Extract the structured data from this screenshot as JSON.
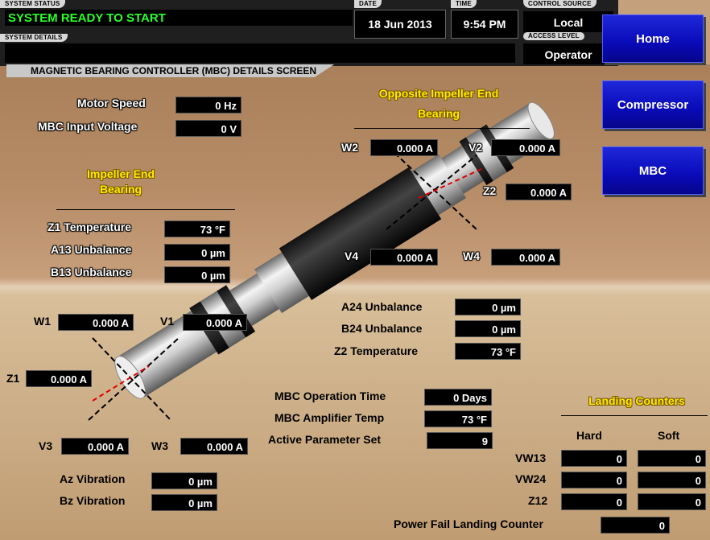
{
  "header": {
    "system_status_label": "SYSTEM STATUS",
    "system_status": "SYSTEM READY TO START",
    "system_details_label": "SYSTEM DETAILS",
    "system_details": "",
    "date_label": "DATE",
    "date": "18 Jun 2013",
    "time_label": "TIME",
    "time": "9:54 PM",
    "control_source_label": "CONTROL SOURCE",
    "control_source": "Local",
    "access_level_label": "ACCESS LEVEL",
    "access_level": "Operator"
  },
  "screen_title": "MAGNETIC BEARING CONTROLLER (MBC) DETAILS SCREEN",
  "nav": {
    "home": "Home",
    "compressor": "Compressor",
    "mbc": "MBC"
  },
  "general": {
    "motor_speed_label": "Motor Speed",
    "motor_speed": "0 Hz",
    "input_voltage_label": "MBC Input Voltage",
    "input_voltage": "0 V"
  },
  "impeller_end": {
    "title_line1": "Impeller End",
    "title_line2": "Bearing",
    "z1_temp_label": "Z1 Temperature",
    "z1_temp": "73 °F",
    "a13_label": "A13 Unbalance",
    "a13": "0 µm",
    "b13_label": "B13 Unbalance",
    "b13": "0 µm",
    "w1_label": "W1",
    "w1": "0.000 A",
    "v1_label": "V1",
    "v1": "0.000 A",
    "z1_label": "Z1",
    "z1": "0.000 A",
    "v3_label": "V3",
    "v3": "0.000 A",
    "w3_label": "W3",
    "w3": "0.000 A"
  },
  "opposite_end": {
    "title_line1": "Opposite Impeller End",
    "title_line2": "Bearing",
    "w2_label": "W2",
    "w2": "0.000 A",
    "v2_label": "V2",
    "v2": "0.000 A",
    "z2_label": "Z2",
    "z2": "0.000 A",
    "v4_label": "V4",
    "v4": "0.000 A",
    "w4_label": "W4",
    "w4": "0.000 A",
    "a24_label": "A24 Unbalance",
    "a24": "0 µm",
    "b24_label": "B24 Unbalance",
    "b24": "0 µm",
    "z2_temp_label": "Z2 Temperature",
    "z2_temp": "73 °F"
  },
  "operation": {
    "op_time_label": "MBC Operation Time",
    "op_time": "0 Days",
    "amp_temp_label": "MBC Amplifier Temp",
    "amp_temp": "73 °F",
    "param_set_label": "Active Parameter Set",
    "param_set": "9"
  },
  "vibration": {
    "az_label": "Az Vibration",
    "az": "0 µm",
    "bz_label": "Bz Vibration",
    "bz": "0 µm"
  },
  "landing": {
    "title": "Landing Counters",
    "hard_label": "Hard",
    "soft_label": "Soft",
    "rows": [
      {
        "label": "VW13",
        "hard": "0",
        "soft": "0"
      },
      {
        "label": "VW24",
        "hard": "0",
        "soft": "0"
      },
      {
        "label": "Z12",
        "hard": "0",
        "soft": "0"
      }
    ],
    "power_fail_label": "Power Fail Landing Counter",
    "power_fail": "0"
  },
  "colors": {
    "status_green": "#28ff28",
    "title_yellow": "#ffea00",
    "nav_blue": "#0a0ab8"
  }
}
